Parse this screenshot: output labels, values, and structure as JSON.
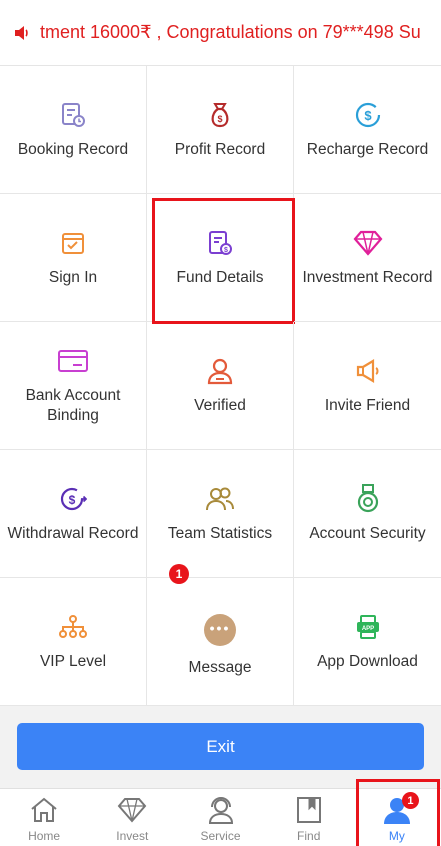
{
  "notice": {
    "text": "tment 16000₹ , Congratulations on 79***498 Su",
    "color": "#e02020"
  },
  "menu": [
    {
      "label": "Booking Record",
      "icon": "booking-record-icon"
    },
    {
      "label": "Profit Record",
      "icon": "money-bag-icon"
    },
    {
      "label": "Recharge Record",
      "icon": "recharge-icon"
    },
    {
      "label": "Sign In",
      "icon": "calendar-check-icon"
    },
    {
      "label": "Fund Details",
      "icon": "fund-details-icon"
    },
    {
      "label": "Investment Record",
      "icon": "diamond-icon"
    },
    {
      "label": "Bank Account Binding",
      "icon": "bank-card-icon"
    },
    {
      "label": "Verified",
      "icon": "user-verified-icon"
    },
    {
      "label": "Invite Friend",
      "icon": "megaphone-icon"
    },
    {
      "label": "Withdrawal Record",
      "icon": "withdrawal-icon"
    },
    {
      "label": "Team Statistics",
      "icon": "team-icon"
    },
    {
      "label": "Account Security",
      "icon": "medal-security-icon"
    },
    {
      "label": "VIP Level",
      "icon": "hierarchy-icon"
    },
    {
      "label": "Message",
      "icon": "chat-bubble-icon",
      "badge": "1"
    },
    {
      "label": "App Download",
      "icon": "app-download-icon"
    }
  ],
  "exit_label": "Exit",
  "tabs": [
    {
      "label": "Home",
      "icon": "home-icon"
    },
    {
      "label": "Invest",
      "icon": "diamond-outline-icon"
    },
    {
      "label": "Service",
      "icon": "headset-icon"
    },
    {
      "label": "Find",
      "icon": "bookmark-icon"
    },
    {
      "label": "My",
      "icon": "user-icon",
      "badge": "1",
      "active": true
    }
  ],
  "colors": {
    "accent": "#3b83f6",
    "highlight_border": "#e8141b"
  }
}
